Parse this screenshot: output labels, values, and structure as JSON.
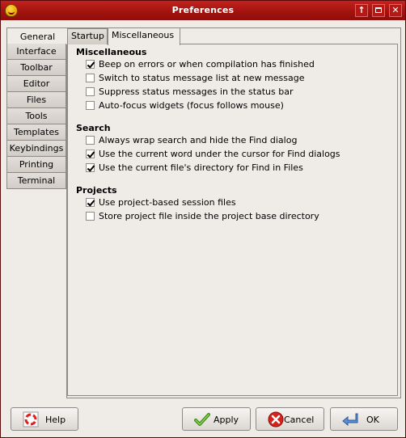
{
  "window": {
    "title": "Preferences",
    "accent": "#a3130f"
  },
  "side_tabs": [
    "General",
    "Interface",
    "Toolbar",
    "Editor",
    "Files",
    "Tools",
    "Templates",
    "Keybindings",
    "Printing",
    "Terminal"
  ],
  "top_tabs": [
    "Startup",
    "Miscellaneous"
  ],
  "sections": {
    "misc": {
      "title": "Miscellaneous",
      "options": [
        {
          "label": "Beep on errors or when compilation has finished",
          "checked": true
        },
        {
          "label": "Switch to status message list at new message",
          "checked": false
        },
        {
          "label": "Suppress status messages in the status bar",
          "checked": false
        },
        {
          "label": "Auto-focus widgets (focus follows mouse)",
          "checked": false
        }
      ]
    },
    "search": {
      "title": "Search",
      "options": [
        {
          "label": "Always wrap search and hide the Find dialog",
          "checked": false
        },
        {
          "label": "Use the current word under the cursor for Find dialogs",
          "checked": true
        },
        {
          "label": "Use the current file's directory for Find in Files",
          "checked": true
        }
      ]
    },
    "projects": {
      "title": "Projects",
      "options": [
        {
          "label": "Use project-based session files",
          "checked": true
        },
        {
          "label": "Store project file inside the project base directory",
          "checked": false
        }
      ]
    }
  },
  "buttons": {
    "help": "Help",
    "apply": "Apply",
    "cancel": "Cancel",
    "ok": "OK"
  }
}
